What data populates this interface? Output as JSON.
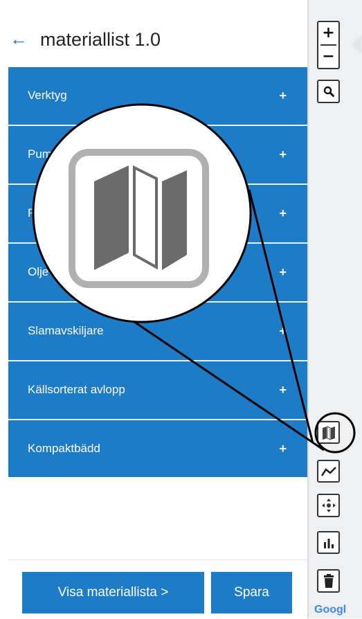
{
  "header": {
    "back_icon": "arrow-left-icon",
    "back_glyph": "←",
    "title": "materiallist 1.0"
  },
  "accordion": {
    "items": [
      {
        "label": "Verktyg",
        "toggle": "+"
      },
      {
        "label": "Pum",
        "toggle": "+"
      },
      {
        "label": "R",
        "toggle": "+"
      },
      {
        "label": "Olje",
        "toggle": "+"
      },
      {
        "label": "Slamavskiljare",
        "toggle": "+"
      },
      {
        "label": "Källsorterat avlopp",
        "toggle": "+"
      },
      {
        "label": "Kompaktbädd",
        "toggle": "+"
      }
    ]
  },
  "footer": {
    "visa_label": "Visa materiallista >",
    "spara_label": "Spara"
  },
  "map": {
    "zoom_in": "+",
    "zoom_out": "−",
    "tools": [
      "search-icon",
      "map-icon",
      "polyline-icon",
      "move-icon",
      "chart-icon",
      "trash-icon"
    ],
    "logo_text": "Googl"
  },
  "colors": {
    "accent": "#1e7bc6",
    "divider": "#eaf2fa",
    "icon_gray": "#6b6b6b"
  }
}
